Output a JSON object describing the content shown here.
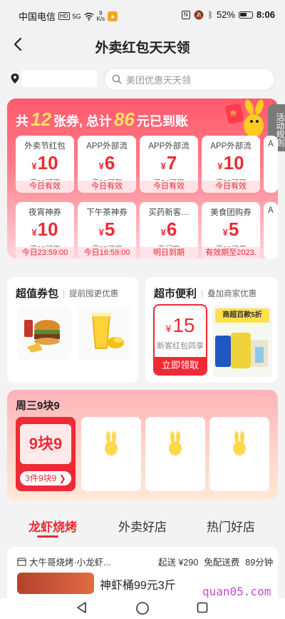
{
  "status_bar": {
    "carrier": "中国电信",
    "hd": "HD",
    "signal": "5G",
    "speed_value": "9",
    "speed_unit": "K/s",
    "battery": "52%",
    "time": "8:06"
  },
  "nav": {
    "back_icon": "chevron-left-icon",
    "title": "外卖红包天天领"
  },
  "search": {
    "placeholder": "美团优惠天天领"
  },
  "banner": {
    "prefix": "共",
    "count": "12",
    "mid": "张券, 总计",
    "total": "86",
    "suffix": "元已到账",
    "rules": "活动规则",
    "coupons": [
      {
        "title": "外卖节红包",
        "currency": "¥",
        "amount": "10",
        "condition": "满20可用",
        "validity": "今日有效"
      },
      {
        "title": "APP外部流",
        "currency": "¥",
        "amount": "6",
        "condition": "满20可用",
        "validity": "今日有效"
      },
      {
        "title": "APP外部流",
        "currency": "¥",
        "amount": "7",
        "condition": "满24可用",
        "validity": "今日有效"
      },
      {
        "title": "APP外部流",
        "currency": "¥",
        "amount": "10",
        "condition": "满35可用",
        "validity": "今日有效"
      },
      {
        "title": "夜宵神券",
        "currency": "¥",
        "amount": "10",
        "condition": "满29可用",
        "validity": "今日23:59:00"
      },
      {
        "title": "下午茶神券",
        "currency": "¥",
        "amount": "5",
        "condition": "满35可用",
        "validity": "今日16:59:00"
      },
      {
        "title": "买药新客…",
        "currency": "¥",
        "amount": "6",
        "condition": "无门槛",
        "validity": "明日到期"
      },
      {
        "title": "美食团购券",
        "currency": "¥",
        "amount": "5",
        "condition": "满69可用",
        "validity": "有效期至2023."
      }
    ],
    "peek_titles": [
      "A",
      "A"
    ]
  },
  "value_pack": {
    "title": "超值券包",
    "subtitle": "提前囤更优惠"
  },
  "supermarket": {
    "title": "超市便利",
    "subtitle": "叠加商家优惠",
    "currency": "¥",
    "amount": "15",
    "note": "新客红包同享",
    "cta": "立即领取",
    "promo": "商超百款5折"
  },
  "wednesday": {
    "title": "周三9块9",
    "badge": "9块9",
    "tag": "3件9块9"
  },
  "tabs": [
    {
      "label": "龙虾烧烤",
      "active": true
    },
    {
      "label": "外卖好店",
      "active": false
    },
    {
      "label": "热门好店",
      "active": false
    }
  ],
  "store": {
    "name": "大牛哥烧烤·小龙虾...",
    "min_order": "起送 ¥290",
    "delivery": "免配送费",
    "time": "89分钟",
    "deal": "神虾桶99元3斤"
  },
  "watermark": "quan05.com",
  "colors": {
    "accent": "#ee2a35",
    "banner": "#ff5a6c"
  }
}
